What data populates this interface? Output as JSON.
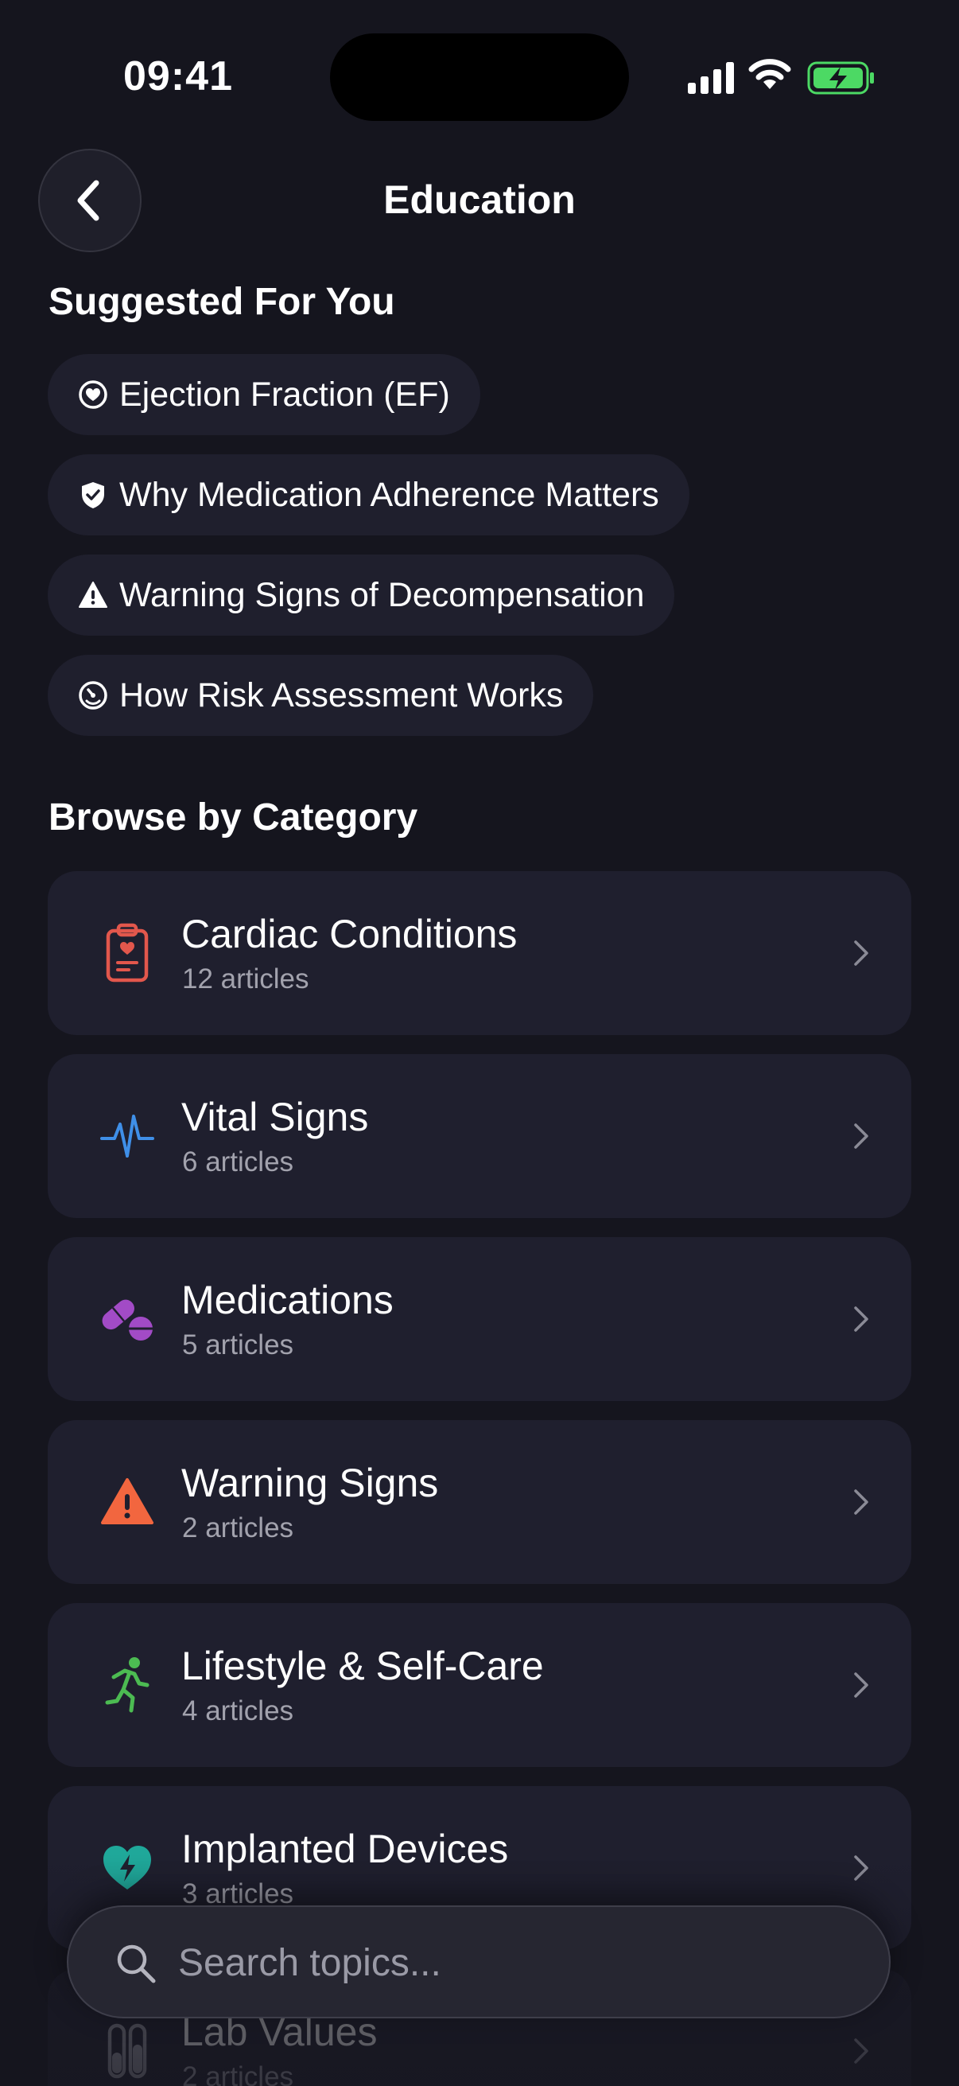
{
  "status_bar": {
    "time": "09:41"
  },
  "header": {
    "title": "Education"
  },
  "suggested": {
    "title": "Suggested For You",
    "chips": [
      {
        "label": "Ejection Fraction (EF)",
        "icon": "heart-circle-icon"
      },
      {
        "label": "Why Medication Adherence Matters",
        "icon": "shield-check-icon"
      },
      {
        "label": "Warning Signs of Decompensation",
        "icon": "warning-triangle-icon"
      },
      {
        "label": "How Risk Assessment Works",
        "icon": "gauge-icon"
      }
    ]
  },
  "browse": {
    "title": "Browse by Category",
    "categories": [
      {
        "name": "Cardiac Conditions",
        "count": "12 articles",
        "icon": "clipboard-heart-icon",
        "color": "#e2574c"
      },
      {
        "name": "Vital Signs",
        "count": "6 articles",
        "icon": "pulse-icon",
        "color": "#3f8fe8"
      },
      {
        "name": "Medications",
        "count": "5 articles",
        "icon": "pills-icon",
        "color": "#a24bc6"
      },
      {
        "name": "Warning Signs",
        "count": "2 articles",
        "icon": "warning-icon",
        "color": "#f2663f"
      },
      {
        "name": "Lifestyle & Self-Care",
        "count": "4 articles",
        "icon": "running-icon",
        "color": "#4cbb52"
      },
      {
        "name": "Implanted Devices",
        "count": "3 articles",
        "icon": "heart-bolt-icon",
        "color": "#1fa89a"
      },
      {
        "name": "Lab Values",
        "count": "2 articles",
        "icon": "test-tubes-icon",
        "color": "#9a9aa6"
      }
    ]
  },
  "search": {
    "placeholder": "Search topics..."
  }
}
